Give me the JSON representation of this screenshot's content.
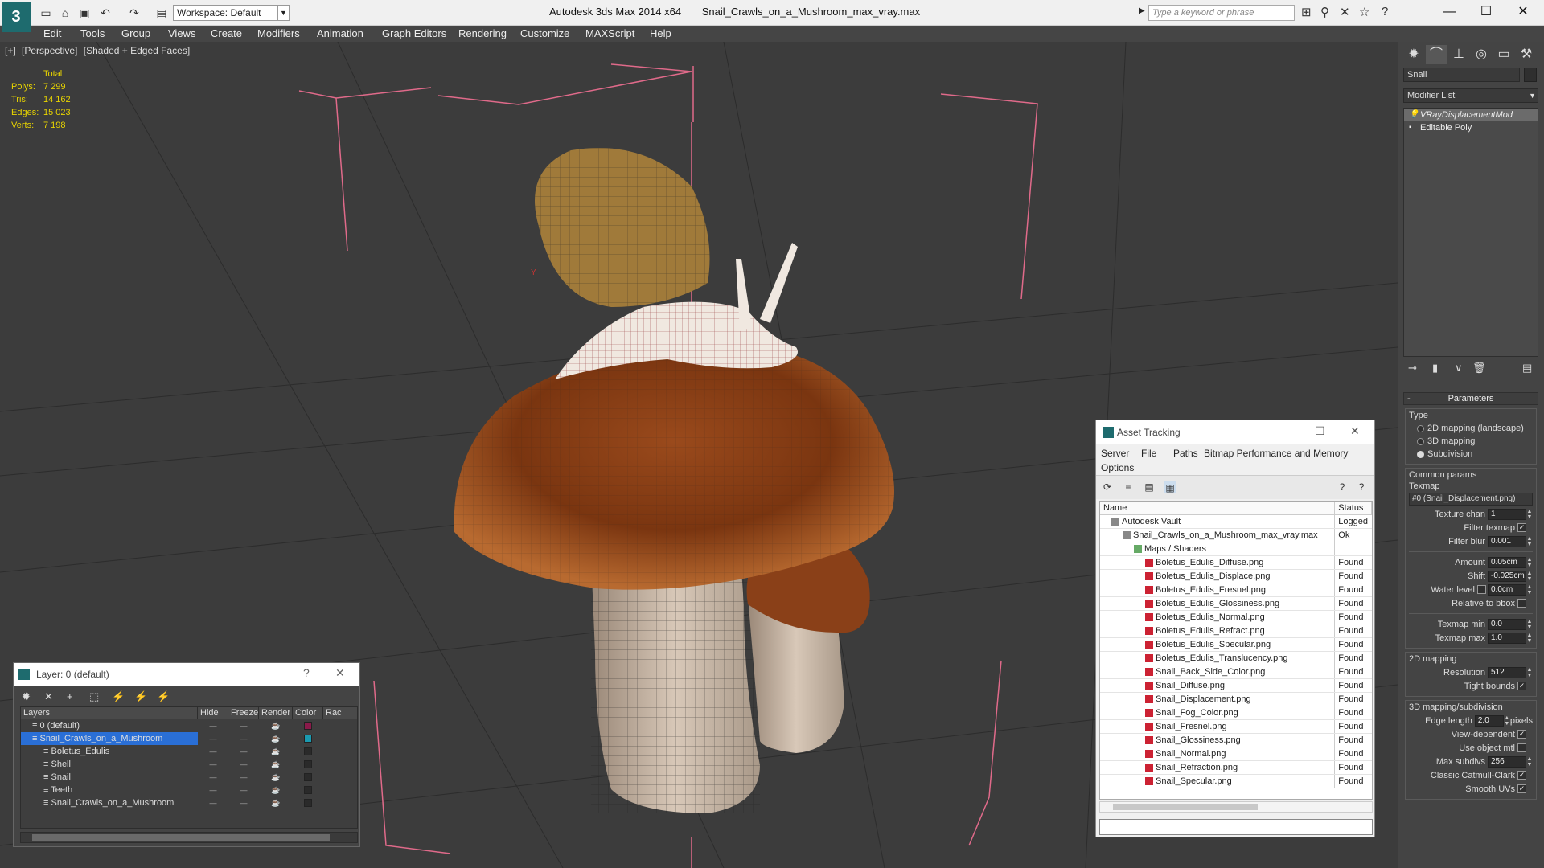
{
  "app": {
    "workspace": "Workspace: Default",
    "title_app": "Autodesk 3ds Max  2014 x64",
    "title_file": "Snail_Crawls_on_a_Mushroom_max_vray.max",
    "search_placeholder": "Type a keyword or phrase"
  },
  "menu": [
    "Edit",
    "Tools",
    "Group",
    "Views",
    "Create",
    "Modifiers",
    "Animation",
    "Graph Editors",
    "Rendering",
    "Customize",
    "MAXScript",
    "Help"
  ],
  "viewport": {
    "labels": [
      "[+]",
      "[Perspective]",
      "[Shaded + Edged Faces]"
    ],
    "stats_header": "Total",
    "stats": [
      {
        "k": "Polys:",
        "v": "7 299"
      },
      {
        "k": "Tris:",
        "v": "14 162"
      },
      {
        "k": "Edges:",
        "v": "15 023"
      },
      {
        "k": "Verts:",
        "v": "7 198"
      }
    ]
  },
  "command_panel": {
    "object_name": "Snail",
    "modifier_list": "Modifier List",
    "stack": [
      "VRayDisplacementMod",
      "Editable Poly"
    ],
    "params_title": "Parameters",
    "type_label": "Type",
    "type_options": [
      {
        "label": "2D mapping (landscape)",
        "on": false
      },
      {
        "label": "3D mapping",
        "on": false
      },
      {
        "label": "Subdivision",
        "on": true
      }
    ],
    "common_label": "Common params",
    "texmap_label": "Texmap",
    "texmap_value": "#0 (Snail_Displacement.png)",
    "texture_chan_label": "Texture chan",
    "texture_chan_value": "1",
    "filter_texmap_label": "Filter texmap",
    "filter_blur_label": "Filter blur",
    "filter_blur_value": "0.001",
    "amount_label": "Amount",
    "amount_value": "0.05cm",
    "shift_label": "Shift",
    "shift_value": "-0.025cm",
    "water_label": "Water level",
    "water_value": "0.0cm",
    "relative_label": "Relative to bbox",
    "texmap_min_label": "Texmap min",
    "texmap_min_value": "0.0",
    "texmap_max_label": "Texmap max",
    "texmap_max_value": "1.0",
    "mapping2d_label": "2D mapping",
    "resolution_label": "Resolution",
    "resolution_value": "512",
    "tight_label": "Tight bounds",
    "mapping3d_label": "3D mapping/subdivision",
    "edge_label": "Edge length",
    "edge_value": "2.0",
    "pixels_label": "pixels",
    "viewdep_label": "View-dependent",
    "useobj_label": "Use object mtl",
    "maxsub_label": "Max subdivs",
    "maxsub_value": "256",
    "catmull_label": "Classic Catmull-Clark",
    "smoothuv_label": "Smooth UVs"
  },
  "asset_tracking": {
    "title": "Asset Tracking",
    "menu": [
      "Server",
      "File",
      "Paths",
      "Bitmap Performance and Memory",
      "Options"
    ],
    "col_name": "Name",
    "col_status": "Status",
    "rows": [
      {
        "name": "Autodesk Vault",
        "status": "Logged",
        "indent": 1,
        "icon": "vault"
      },
      {
        "name": "Snail_Crawls_on_a_Mushroom_max_vray.max",
        "status": "Ok",
        "indent": 2,
        "icon": "file"
      },
      {
        "name": "Maps / Shaders",
        "status": "",
        "indent": 3,
        "icon": "folder"
      },
      {
        "name": "Boletus_Edulis_Diffuse.png",
        "status": "Found",
        "indent": 4,
        "icon": "png"
      },
      {
        "name": "Boletus_Edulis_Displace.png",
        "status": "Found",
        "indent": 4,
        "icon": "png"
      },
      {
        "name": "Boletus_Edulis_Fresnel.png",
        "status": "Found",
        "indent": 4,
        "icon": "png"
      },
      {
        "name": "Boletus_Edulis_Glossiness.png",
        "status": "Found",
        "indent": 4,
        "icon": "png"
      },
      {
        "name": "Boletus_Edulis_Normal.png",
        "status": "Found",
        "indent": 4,
        "icon": "png"
      },
      {
        "name": "Boletus_Edulis_Refract.png",
        "status": "Found",
        "indent": 4,
        "icon": "png"
      },
      {
        "name": "Boletus_Edulis_Specular.png",
        "status": "Found",
        "indent": 4,
        "icon": "png"
      },
      {
        "name": "Boletus_Edulis_Translucency.png",
        "status": "Found",
        "indent": 4,
        "icon": "png"
      },
      {
        "name": "Snail_Back_Side_Color.png",
        "status": "Found",
        "indent": 4,
        "icon": "png"
      },
      {
        "name": "Snail_Diffuse.png",
        "status": "Found",
        "indent": 4,
        "icon": "png"
      },
      {
        "name": "Snail_Displacement.png",
        "status": "Found",
        "indent": 4,
        "icon": "png"
      },
      {
        "name": "Snail_Fog_Color.png",
        "status": "Found",
        "indent": 4,
        "icon": "png"
      },
      {
        "name": "Snail_Fresnel.png",
        "status": "Found",
        "indent": 4,
        "icon": "png"
      },
      {
        "name": "Snail_Glossiness.png",
        "status": "Found",
        "indent": 4,
        "icon": "png"
      },
      {
        "name": "Snail_Normal.png",
        "status": "Found",
        "indent": 4,
        "icon": "png"
      },
      {
        "name": "Snail_Refraction.png",
        "status": "Found",
        "indent": 4,
        "icon": "png"
      },
      {
        "name": "Snail_Specular.png",
        "status": "Found",
        "indent": 4,
        "icon": "png"
      }
    ]
  },
  "layer_dialog": {
    "title": "Layer: 0 (default)",
    "help": "?",
    "cols": [
      "Layers",
      "Hide",
      "Freeze",
      "Render",
      "Color",
      "Rac"
    ],
    "rows": [
      {
        "name": "0 (default)",
        "indent": 1,
        "color": "#8a1a4a",
        "check": "✓",
        "selected": false
      },
      {
        "name": "Snail_Crawls_on_a_Mushroom",
        "indent": 1,
        "color": "#1a9ab0",
        "check": "",
        "selected": true
      },
      {
        "name": "Boletus_Edulis",
        "indent": 2,
        "color": "#2a2a2a",
        "check": "",
        "selected": false
      },
      {
        "name": "Shell",
        "indent": 2,
        "color": "#2a2a2a",
        "check": "",
        "selected": false
      },
      {
        "name": "Snail",
        "indent": 2,
        "color": "#2a2a2a",
        "check": "",
        "selected": false
      },
      {
        "name": "Teeth",
        "indent": 2,
        "color": "#2a2a2a",
        "check": "",
        "selected": false
      },
      {
        "name": "Snail_Crawls_on_a_Mushroom",
        "indent": 2,
        "color": "#2a2a2a",
        "check": "",
        "selected": false
      }
    ]
  }
}
